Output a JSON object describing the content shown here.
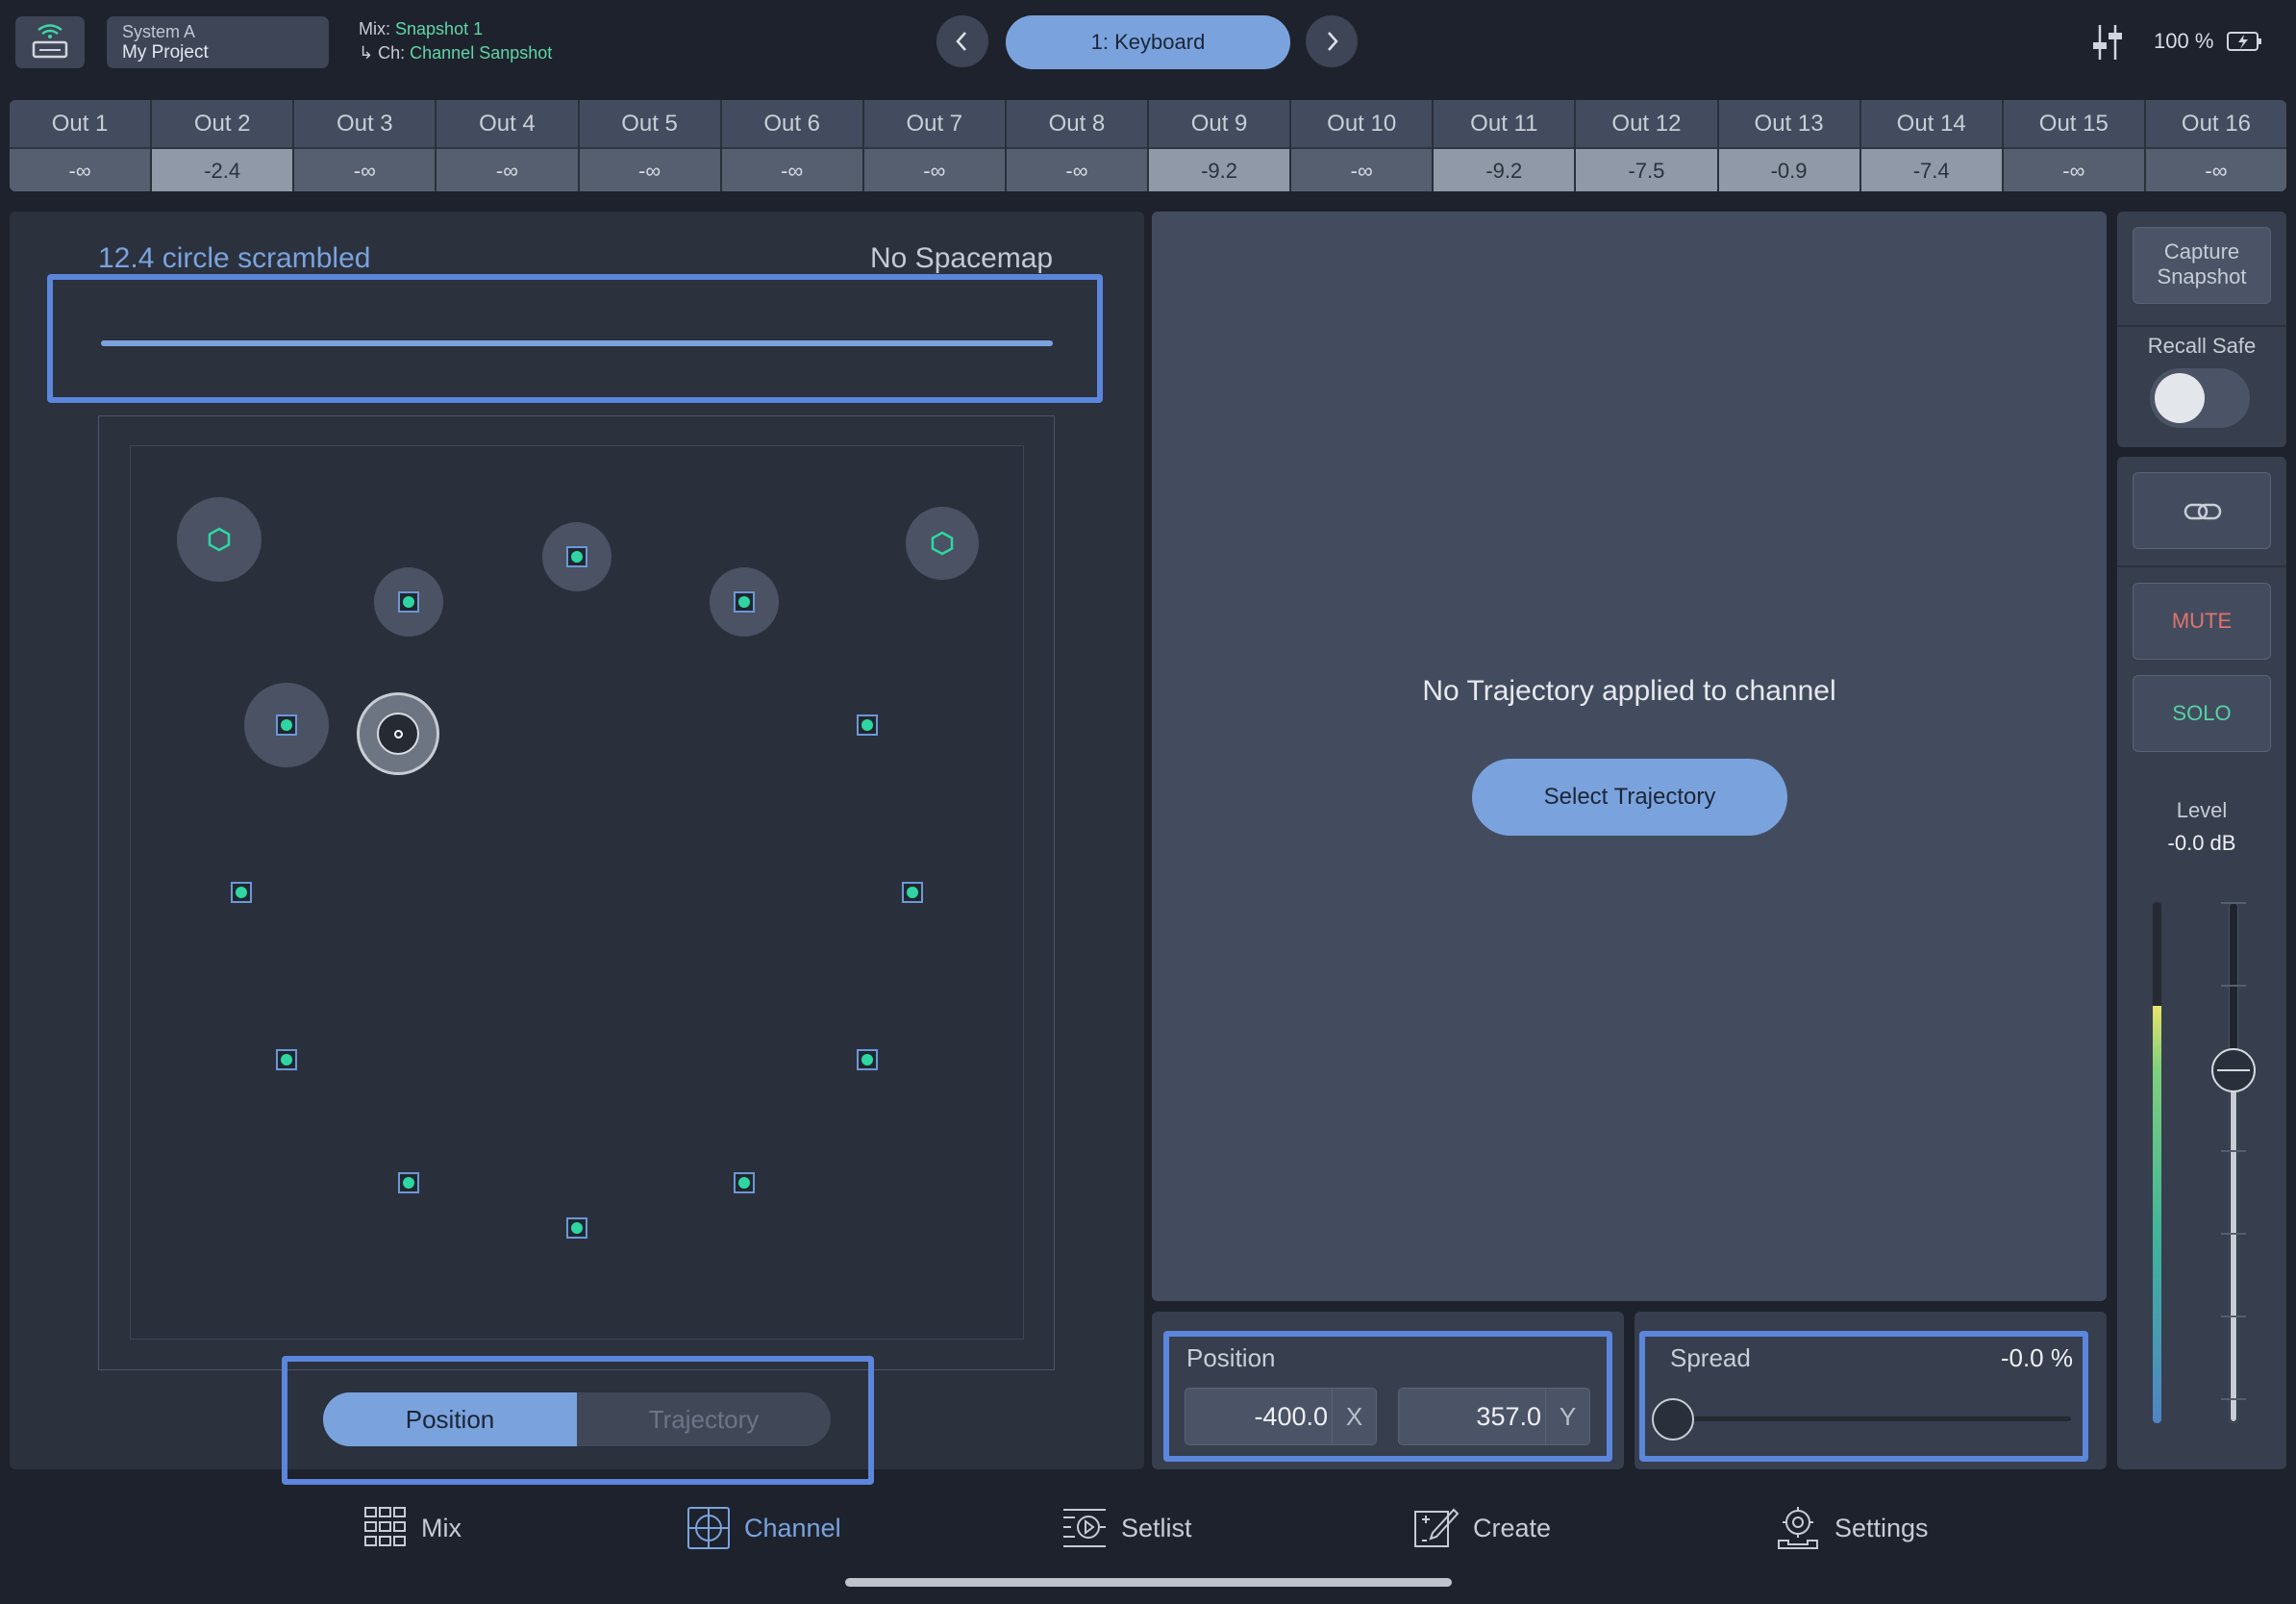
{
  "header": {
    "system_name": "System A",
    "project_name": "My Project",
    "mix_label": "Mix:",
    "mix_value": "Snapshot 1",
    "channel_label": "Ch:",
    "channel_value": "Channel Sanpshot",
    "current_snapshot": "1: Keyboard",
    "battery": "100 %"
  },
  "outputs": [
    {
      "name": "Out 1",
      "value": "-∞",
      "active": false
    },
    {
      "name": "Out 2",
      "value": "-2.4",
      "active": true
    },
    {
      "name": "Out 3",
      "value": "-∞",
      "active": false
    },
    {
      "name": "Out 4",
      "value": "-∞",
      "active": false
    },
    {
      "name": "Out 5",
      "value": "-∞",
      "active": false
    },
    {
      "name": "Out 6",
      "value": "-∞",
      "active": false
    },
    {
      "name": "Out 7",
      "value": "-∞",
      "active": false
    },
    {
      "name": "Out 8",
      "value": "-∞",
      "active": false
    },
    {
      "name": "Out 9",
      "value": "-9.2",
      "active": true
    },
    {
      "name": "Out 10",
      "value": "-∞",
      "active": false
    },
    {
      "name": "Out 11",
      "value": "-9.2",
      "active": true
    },
    {
      "name": "Out 12",
      "value": "-7.5",
      "active": true
    },
    {
      "name": "Out 13",
      "value": "-0.9",
      "active": true
    },
    {
      "name": "Out 14",
      "value": "-7.4",
      "active": true
    },
    {
      "name": "Out 15",
      "value": "-∞",
      "active": false
    },
    {
      "name": "Out 16",
      "value": "-∞",
      "active": false
    }
  ],
  "speaker_layout": {
    "name": "12.4 circle scrambled",
    "spacemap": "No Spacemap"
  },
  "view_toggle": {
    "position_label": "Position",
    "trajectory_label": "Trajectory",
    "selected": "Position"
  },
  "trajectory": {
    "message": "No Trajectory applied to channel",
    "select_label": "Select Trajectory"
  },
  "position": {
    "label": "Position",
    "x": "-400.0",
    "x_axis": "X",
    "y": "357.0",
    "y_axis": "Y"
  },
  "spread": {
    "label": "Spread",
    "value": "-0.0 %",
    "fraction": 0.0
  },
  "controls": {
    "capture_label_1": "Capture",
    "capture_label_2": "Snapshot",
    "recall_safe_label": "Recall Safe",
    "recall_safe_on": false,
    "mute_label": "MUTE",
    "solo_label": "SOLO",
    "level_label": "Level",
    "level_value": "-0.0 dB",
    "meter_fraction": 0.8
  },
  "tabs": [
    {
      "label": "Mix",
      "icon": "mix-grid-icon"
    },
    {
      "label": "Channel",
      "icon": "channel-target-icon",
      "active": true
    },
    {
      "label": "Setlist",
      "icon": "setlist-icon"
    },
    {
      "label": "Create",
      "icon": "create-pencil-icon"
    },
    {
      "label": "Settings",
      "icon": "settings-gear-icon"
    }
  ],
  "colors": {
    "accent": "#7aa3de",
    "speaker_green": "#2fd6a4",
    "mute_red": "#e0736d",
    "solo_green": "#55d3a6",
    "background": "#1e222c"
  }
}
